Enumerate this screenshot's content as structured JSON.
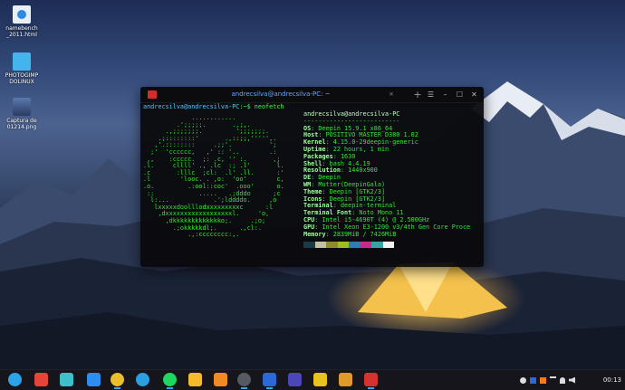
{
  "desktop": {
    "icons": [
      {
        "name": "namebench-html",
        "label": "namebench\n_2011.html",
        "color": "#e9eef8",
        "glyph": "chrome-icon"
      },
      {
        "name": "photogimp-folder",
        "label": "PHOTOGIMP\nDOLINUX",
        "color": "#42b4ee",
        "glyph": "folder-icon"
      },
      {
        "name": "captura-image",
        "label": "Captura de\n01214.png",
        "color": "#3a5584",
        "glyph": "image-icon"
      }
    ]
  },
  "terminal": {
    "tab_title": "andrecsilva@andrecsilva-PC: ~",
    "tab_close": "×",
    "new_tab": "+",
    "controls": {
      "menu": "☰",
      "minimize": "–",
      "maximize": "☐",
      "close": "✕"
    },
    "prompt_user": "andrecsilva@andrecsilva-PC",
    "prompt_rest": ":~$ neofetch",
    "ascii_art": "             ............\n         .';;;;;.       .,;,.\n      .,;;;;;;;.         ';;;;;;;.\n    .;::::::::'       .,::;;,''''',.\n   ,'.::::::::     .;;'.          ';\n  ;'  'cccccc,   ,' :: '..        .:\n ,,    :ccccc.  ;: .c, '' :.       ,;\n.l.     cllll' ., .lc  :; .l'       l.\n.c       :lllc  ;cl:  .l' .ll.      :'\n.l        'looc. . ,o:  'oo'        c,\n.o.         .:ool::coc'  .ooo'      o.\n ::            .....   .;dddo      ;c\n  l:...            .';lddddo.     ,o\n   lxxxxxdoolllodxxxxxxxxxc      :l\n    ,dxxxxxxxxxxxxxxxxxxl.     'o,\n      ,dkkkkkkkkkkkkko;.     .;o;\n        .;okkkkkdl;.      .,cl:.\n            .,:cccccccc:,.",
    "header": "andrecsilva@andrecsilva-PC",
    "separator": "--------------------------",
    "info": [
      {
        "key": "OS",
        "value": "Deepin 15.9.1 x86_64"
      },
      {
        "key": "Host",
        "value": "POSITIVO MASTER D380 1.02"
      },
      {
        "key": "Kernel",
        "value": "4.15.0-29deepin-generic"
      },
      {
        "key": "Uptime",
        "value": "22 hours, 1 min"
      },
      {
        "key": "Packages",
        "value": "1630"
      },
      {
        "key": "Shell",
        "value": "bash 4.4.19"
      },
      {
        "key": "Resolution",
        "value": "1440x900"
      },
      {
        "key": "DE",
        "value": "Deepin"
      },
      {
        "key": "WM",
        "value": "Mutter(DeepinGala)"
      },
      {
        "key": "Theme",
        "value": "Deepin [GTK2/3]"
      },
      {
        "key": "Icons",
        "value": "Deepin [GTK2/3]"
      },
      {
        "key": "Terminal",
        "value": "deepin-terminal"
      },
      {
        "key": "Terminal Font",
        "value": "Noto Mono 11"
      },
      {
        "key": "CPU",
        "value": "Intel i5-4690T (4) @ 2.500GHz"
      },
      {
        "key": "GPU",
        "value": "Intel Xeon E3-1200 v3/4th Gen Core Proce"
      },
      {
        "key": "Memory",
        "value": "2839MiB / 7426MiB"
      }
    ],
    "swatches": [
      "#1b3a47",
      "#c2c2a3",
      "#8d8d2a",
      "#9fbf1f",
      "#2b7fb0",
      "#cc2a8a",
      "#37a3a3",
      "#f2f2ee"
    ]
  },
  "taskbar": {
    "apps": [
      {
        "name": "launcher-icon",
        "color": "#2aa3e8",
        "round": true,
        "active": false
      },
      {
        "name": "multitask-view-icon",
        "color": "#e4443a",
        "round": false,
        "active": false
      },
      {
        "name": "file-manager-icon",
        "color": "#3ec0c9",
        "round": false,
        "active": false
      },
      {
        "name": "app-store-icon",
        "color": "#2d8ef1",
        "round": false,
        "active": false
      },
      {
        "name": "chrome-icon",
        "color": "#e9c02b",
        "round": true,
        "active": true
      },
      {
        "name": "telegram-icon",
        "color": "#2b9fe0",
        "round": true,
        "active": false
      },
      {
        "name": "spotify-icon",
        "color": "#1ed760",
        "round": true,
        "active": true
      },
      {
        "name": "music-player-icon",
        "color": "#f4bb2a",
        "round": false,
        "active": false
      },
      {
        "name": "system-monitor-icon",
        "color": "#f08a24",
        "round": false,
        "active": false
      },
      {
        "name": "steam-icon",
        "color": "#555a63",
        "round": true,
        "active": true
      },
      {
        "name": "bitwarden-icon",
        "color": "#2e67d8",
        "round": false,
        "active": true
      },
      {
        "name": "audio-mixer-icon",
        "color": "#4c46b8",
        "round": false,
        "active": false
      },
      {
        "name": "editor-icon",
        "color": "#e8c21e",
        "round": false,
        "active": false
      },
      {
        "name": "trash-icon",
        "color": "#e09a2c",
        "round": false,
        "active": false
      },
      {
        "name": "terminal-icon",
        "color": "#d6322f",
        "round": false,
        "active": true
      }
    ],
    "clock": "00:13"
  }
}
